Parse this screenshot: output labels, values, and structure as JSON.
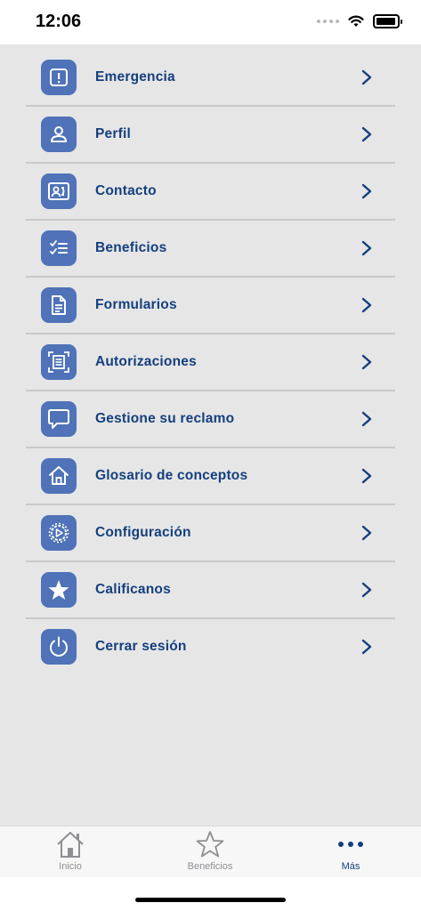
{
  "status_bar": {
    "time": "12:06"
  },
  "menu": {
    "items": [
      {
        "label": "Emergencia",
        "icon": "emergency-icon"
      },
      {
        "label": "Perfil",
        "icon": "person-icon"
      },
      {
        "label": "Contacto",
        "icon": "contact-card-icon"
      },
      {
        "label": "Beneficios",
        "icon": "checklist-icon"
      },
      {
        "label": "Formularios",
        "icon": "document-icon"
      },
      {
        "label": "Autorizaciones",
        "icon": "scan-document-icon"
      },
      {
        "label": "Gestione su reclamo",
        "icon": "chat-bubble-icon"
      },
      {
        "label": "Glosario de conceptos",
        "icon": "home-icon"
      },
      {
        "label": "Configuración",
        "icon": "settings-gear-icon"
      },
      {
        "label": "Calificanos",
        "icon": "star-icon"
      },
      {
        "label": "Cerrar sesión",
        "icon": "power-icon"
      }
    ]
  },
  "tabbar": {
    "tabs": [
      {
        "label": "Inicio",
        "icon": "home-outline-icon"
      },
      {
        "label": "Beneficios",
        "icon": "star-outline-icon"
      },
      {
        "label": "Más",
        "icon": "more-dots-icon",
        "active": true
      }
    ]
  },
  "colors": {
    "accent": "#4f72b8",
    "label": "#143f7e",
    "background": "#e6e6e6",
    "divider": "#c9c9c9",
    "inactive_tab": "#8e8e93"
  }
}
